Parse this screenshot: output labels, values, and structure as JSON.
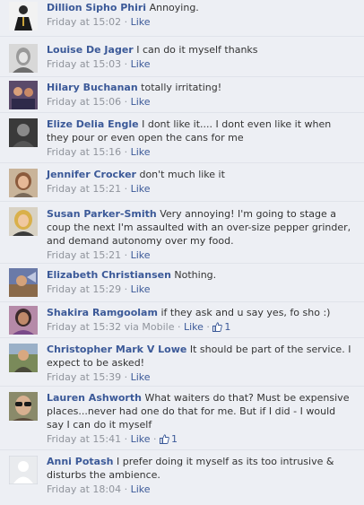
{
  "comments": [
    {
      "author": "Dillion Sipho Phiri",
      "text": "Annoying.",
      "time": "Friday at 15:02",
      "like": "Like",
      "avatar": "avatar-icon-suit"
    },
    {
      "author": "Louise De Jager",
      "text": "I can do it myself thanks",
      "time": "Friday at 15:03",
      "like": "Like",
      "avatar": "avatar-icon-bw"
    },
    {
      "author": "Hilary Buchanan",
      "text": "totally irritating!",
      "time": "Friday at 15:06",
      "like": "Like",
      "avatar": "avatar-icon-group"
    },
    {
      "author": "Elize Delia Engle",
      "text": "I dont like it.... I dont even like it when they pour or even open the cans for me",
      "time": "Friday at 15:16",
      "like": "Like",
      "avatar": "avatar-icon-dark"
    },
    {
      "author": "Jennifer Crocker",
      "text": "don't much like it",
      "time": "Friday at 15:21",
      "like": "Like",
      "avatar": "avatar-icon-woman"
    },
    {
      "author": "Susan Parker-Smith",
      "text": "Very annoying! I'm going to stage a coup the next I'm assaulted with an over-size pepper grinder, and demand autonomy over my food.",
      "time": "Friday at 15:21",
      "like": "Like",
      "avatar": "avatar-icon-blonde"
    },
    {
      "author": "Elizabeth Christiansen",
      "text": "Nothing.",
      "time": "Friday at 15:29",
      "like": "Like",
      "avatar": "avatar-icon-landscape"
    },
    {
      "author": "Shakira Ramgoolam",
      "text": "if they ask and u say yes, fo sho :)",
      "time": "Friday at 15:32 via Mobile",
      "like": "Like",
      "likes": "1",
      "avatar": "avatar-icon-purple"
    },
    {
      "author": "Christopher Mark V Lowe",
      "text": "It should be part of the service. I expect to be asked!",
      "time": "Friday at 15:39",
      "like": "Like",
      "avatar": "avatar-icon-outdoor"
    },
    {
      "author": "Lauren Ashworth",
      "text": "What waiters do that? Must be expensive places...never had one do that for me. But if I did - I would say I can do it myself",
      "time": "Friday at 15:41",
      "like": "Like",
      "likes": "1",
      "avatar": "avatar-icon-sunglasses"
    },
    {
      "author": "Anni Potash",
      "text": "I prefer doing it myself as its too intrusive & disturbs the ambience.",
      "time": "Friday at 18:04",
      "like": "Like",
      "avatar": "default-avatar-icon"
    }
  ]
}
